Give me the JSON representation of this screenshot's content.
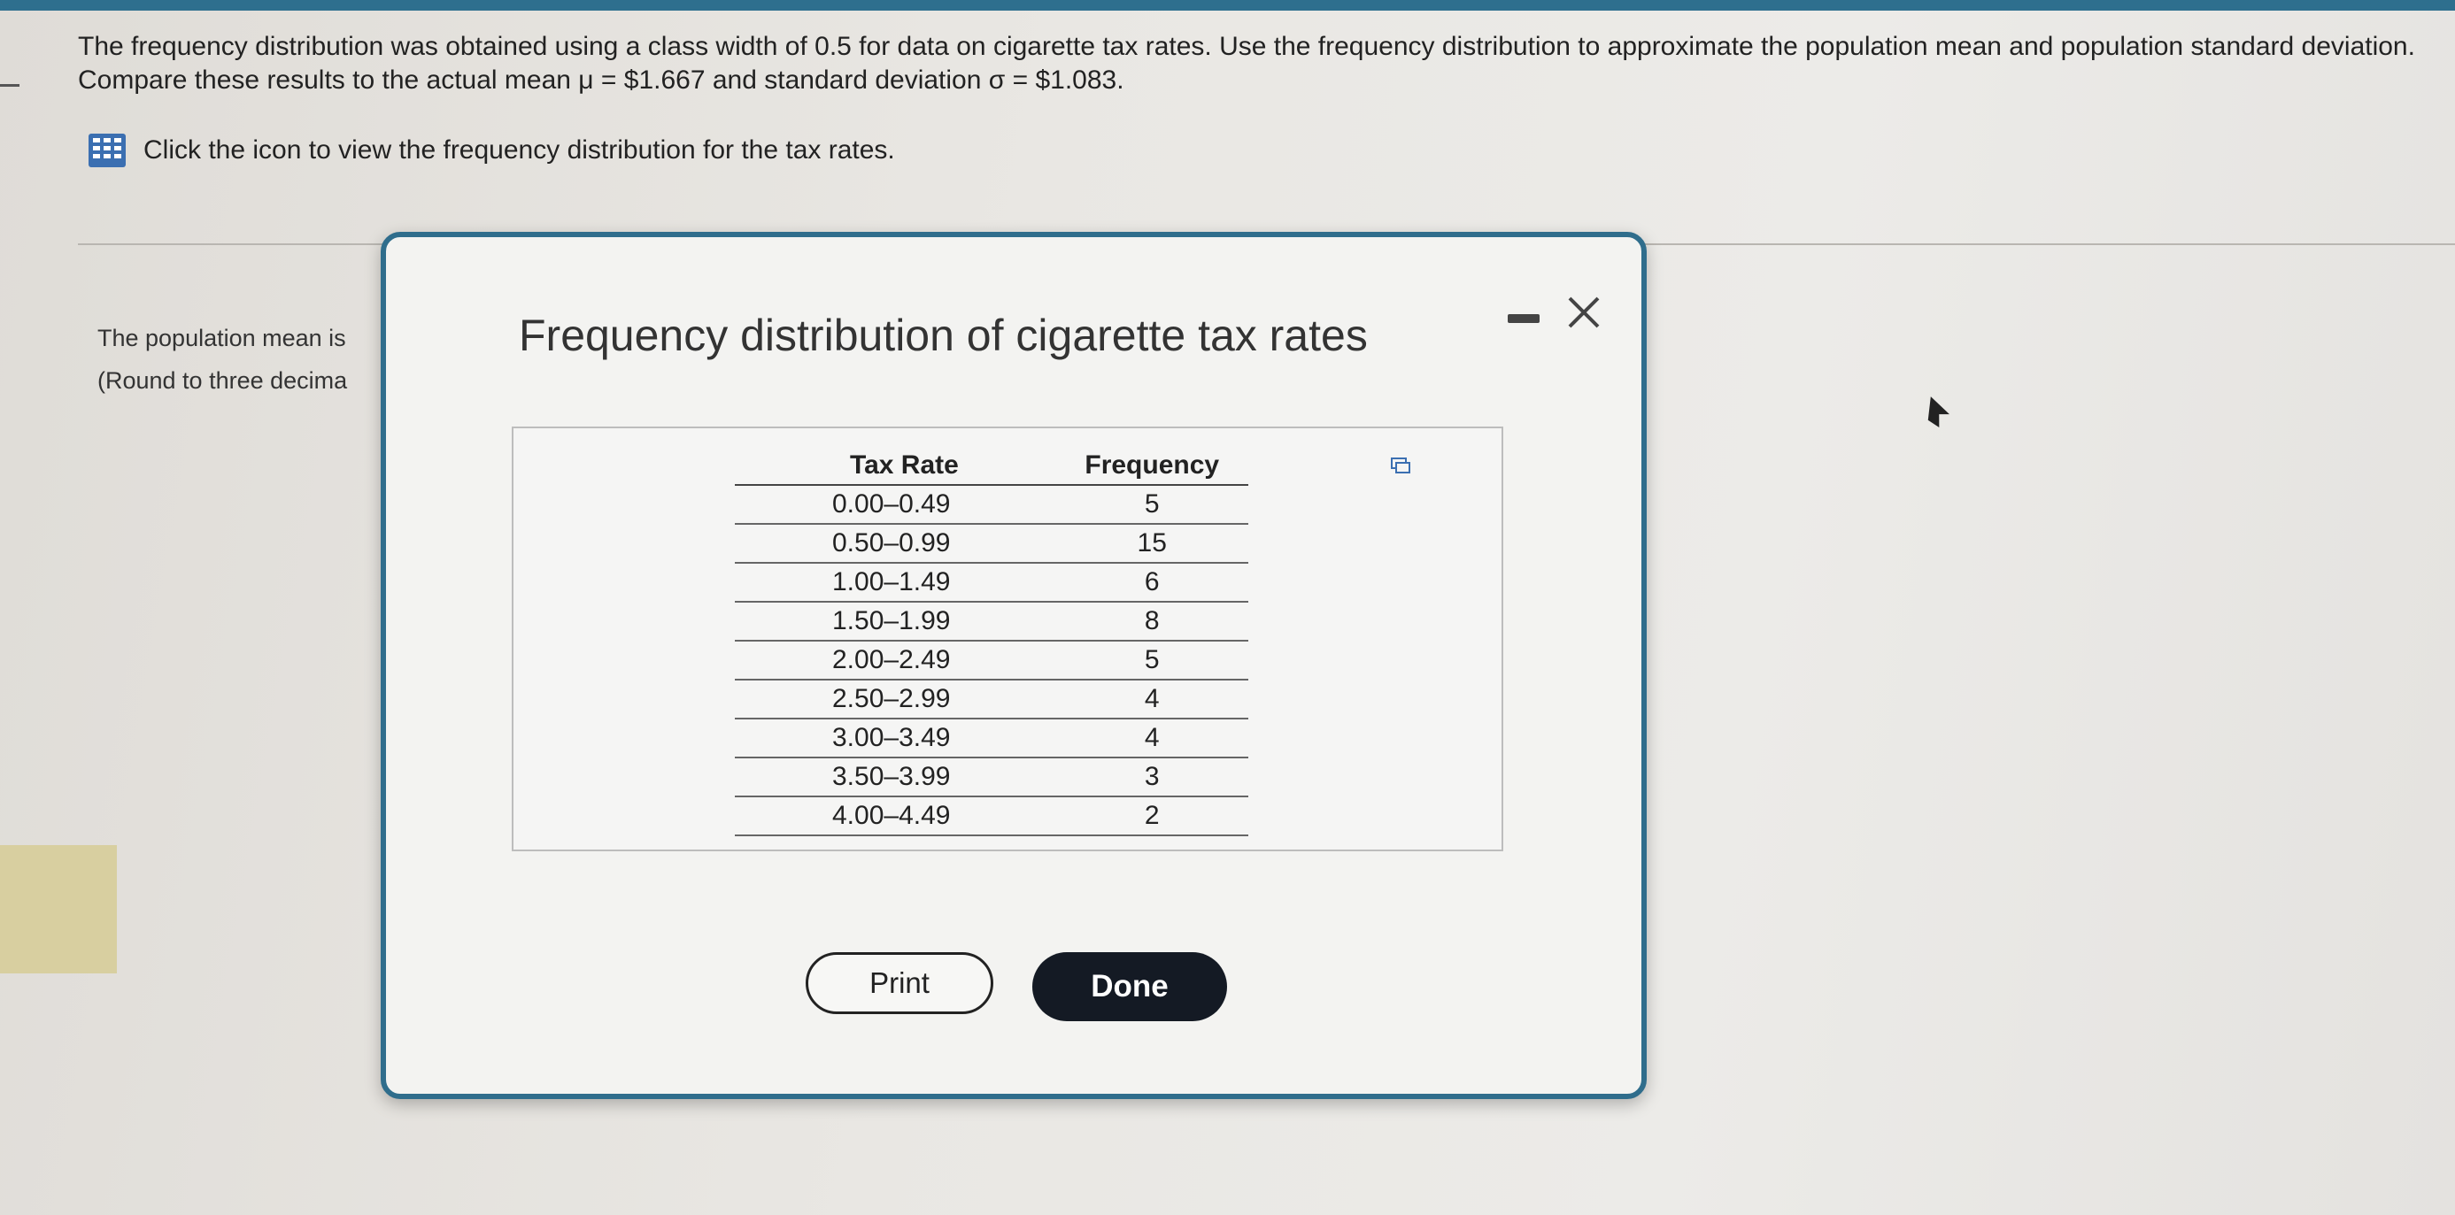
{
  "question": {
    "text": "The frequency distribution was obtained using a class width of 0.5 for data on cigarette tax rates. Use the frequency distribution to approximate the population mean and population standard deviation. Compare these results to the actual mean μ = $1.667 and standard deviation σ = $1.083."
  },
  "info": {
    "icon": "table-grid-icon",
    "text": "Click the icon to view the frequency distribution for the tax rates."
  },
  "answer_area": {
    "line1": "The population mean is",
    "line2": "(Round to three decima"
  },
  "modal": {
    "title": "Frequency distribution of cigarette tax rates",
    "columns": [
      "Tax Rate",
      "Frequency"
    ],
    "rows": [
      {
        "rate": "0.00–0.49",
        "freq": "5"
      },
      {
        "rate": "0.50–0.99",
        "freq": "15"
      },
      {
        "rate": "1.00–1.49",
        "freq": "6"
      },
      {
        "rate": "1.50–1.99",
        "freq": "8"
      },
      {
        "rate": "2.00–2.49",
        "freq": "5"
      },
      {
        "rate": "2.50–2.99",
        "freq": "4"
      },
      {
        "rate": "3.00–3.49",
        "freq": "4"
      },
      {
        "rate": "3.50–3.99",
        "freq": "3"
      },
      {
        "rate": "4.00–4.49",
        "freq": "2"
      }
    ],
    "print_label": "Print",
    "done_label": "Done"
  },
  "colors": {
    "accent": "#2f6d8c",
    "icon_blue": "#3b6fb1",
    "done_bg": "#141a24"
  }
}
